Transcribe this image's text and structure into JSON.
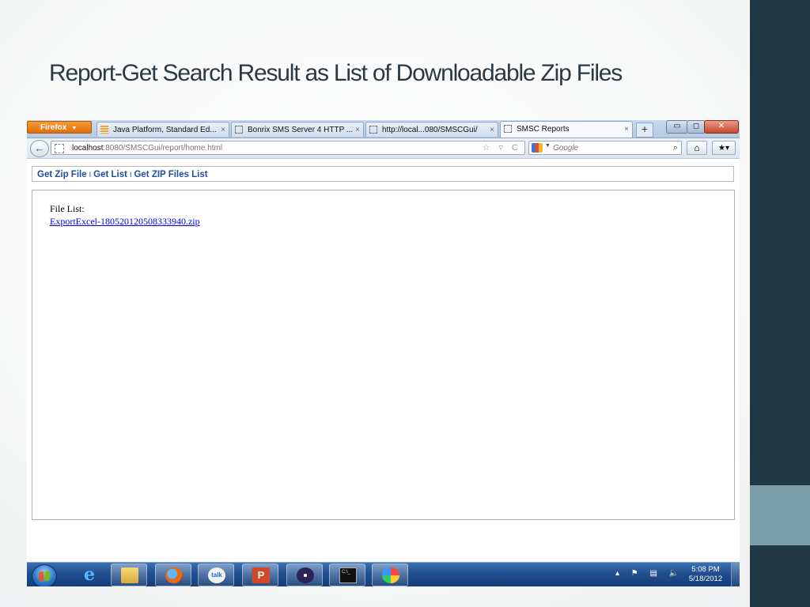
{
  "slide": {
    "title": "Report-Get Search Result as List of Downloadable Zip Files"
  },
  "browser": {
    "app_button": "Firefox",
    "tabs": [
      {
        "label": "Java Platform, Standard Ed...",
        "close": "×"
      },
      {
        "label": "Bonrix SMS Server 4 HTTP ...",
        "close": "×"
      },
      {
        "label": "http://local...080/SMSCGui/",
        "close": "×"
      },
      {
        "label": "SMSC Reports",
        "close": "×"
      }
    ],
    "new_tab": "+",
    "window": {
      "minimize": "▭",
      "maximize": "◻",
      "close": "✕"
    },
    "url_host": "localhost",
    "url_rest": ":8080/SMSCGui/report/home.html",
    "url_tools": "☆ ▿ C",
    "search_placeholder": "Google",
    "search_icon": "⌕",
    "home_icon": "⌂",
    "bookmarks_icon": "★▾",
    "back_icon": "←"
  },
  "page": {
    "menu": [
      "Get Zip File",
      "Get List",
      "Get ZIP Files List"
    ],
    "menu_separator": "I",
    "file_list_label": "File List:",
    "files": [
      "ExportExcel-180520120508333940.zip"
    ]
  },
  "taskbar": {
    "apps": [
      "ie-icon",
      "folder-icon",
      "firefox-icon",
      "gtalk-icon",
      "powerpoint-icon",
      "eclipse-icon",
      "cmd-icon",
      "paint-icon"
    ],
    "gtalk_text": "talk",
    "ppt_text": "P",
    "cmd_text": "C:\\_",
    "tray_icons": "▴ ⚑ ▤ 🔈",
    "time": "5:08 PM",
    "date": "5/18/2012"
  }
}
